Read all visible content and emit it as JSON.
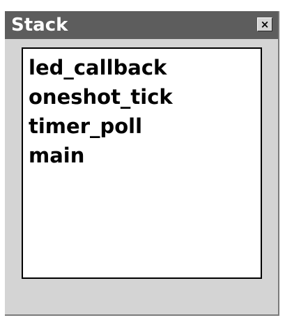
{
  "window": {
    "title": "Stack",
    "close_glyph": "×"
  },
  "stack": {
    "frames": [
      {
        "label": "led_callback"
      },
      {
        "label": "oneshot_tick"
      },
      {
        "label": "timer_poll"
      },
      {
        "label": "main"
      }
    ]
  },
  "icons": {
    "close": "close-icon"
  },
  "colors": {
    "titlebar": "#5d5d5d",
    "window_bg": "#d4d4d4",
    "list_bg": "#ffffff",
    "text": "#000000"
  }
}
